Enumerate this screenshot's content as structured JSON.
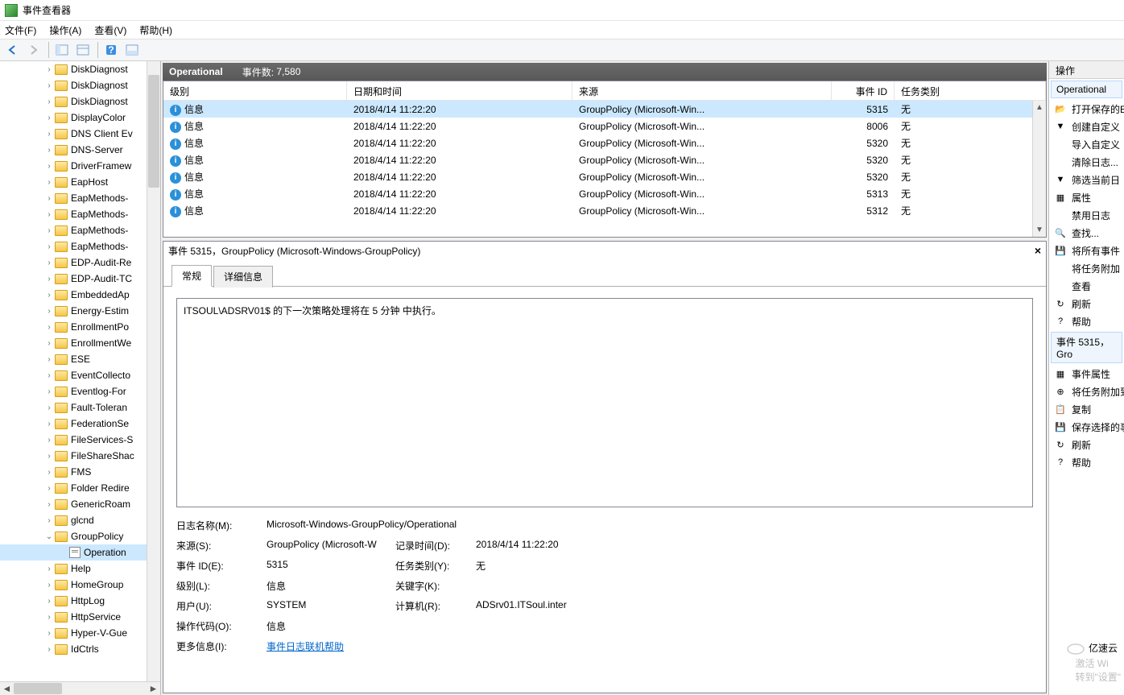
{
  "window": {
    "title": "事件查看器"
  },
  "menu": {
    "file": "文件(F)",
    "action": "操作(A)",
    "view": "查看(V)",
    "help": "帮助(H)"
  },
  "tree": {
    "items": [
      {
        "l": "DiskDiagnost",
        "d": 3
      },
      {
        "l": "DiskDiagnost",
        "d": 3
      },
      {
        "l": "DiskDiagnost",
        "d": 3
      },
      {
        "l": "DisplayColor",
        "d": 3
      },
      {
        "l": "DNS Client Ev",
        "d": 3
      },
      {
        "l": "DNS-Server",
        "d": 3
      },
      {
        "l": "DriverFramew",
        "d": 3
      },
      {
        "l": "EapHost",
        "d": 3
      },
      {
        "l": "EapMethods-",
        "d": 3
      },
      {
        "l": "EapMethods-",
        "d": 3
      },
      {
        "l": "EapMethods-",
        "d": 3
      },
      {
        "l": "EapMethods-",
        "d": 3
      },
      {
        "l": "EDP-Audit-Re",
        "d": 3
      },
      {
        "l": "EDP-Audit-TC",
        "d": 3
      },
      {
        "l": "EmbeddedAp",
        "d": 3
      },
      {
        "l": "Energy-Estim",
        "d": 3
      },
      {
        "l": "EnrollmentPo",
        "d": 3
      },
      {
        "l": "EnrollmentWe",
        "d": 3
      },
      {
        "l": "ESE",
        "d": 3
      },
      {
        "l": "EventCollecto",
        "d": 3
      },
      {
        "l": "Eventlog-For",
        "d": 3
      },
      {
        "l": "Fault-Toleran",
        "d": 3
      },
      {
        "l": "FederationSe",
        "d": 3
      },
      {
        "l": "FileServices-S",
        "d": 3
      },
      {
        "l": "FileShareShac",
        "d": 3
      },
      {
        "l": "FMS",
        "d": 3
      },
      {
        "l": "Folder Redire",
        "d": 3
      },
      {
        "l": "GenericRoam",
        "d": 3
      },
      {
        "l": "glcnd",
        "d": 3
      },
      {
        "l": "GroupPolicy",
        "d": 3,
        "exp": true
      },
      {
        "l": "Operation",
        "d": 4,
        "log": true,
        "sel": true
      },
      {
        "l": "Help",
        "d": 3
      },
      {
        "l": "HomeGroup",
        "d": 3
      },
      {
        "l": "HttpLog",
        "d": 3
      },
      {
        "l": "HttpService",
        "d": 3
      },
      {
        "l": "Hyper-V-Gue",
        "d": 3
      },
      {
        "l": "IdCtrls",
        "d": 3
      }
    ]
  },
  "log": {
    "name": "Operational",
    "count_label": "事件数:",
    "count": "7,580",
    "columns": {
      "level": "级别",
      "datetime": "日期和时间",
      "source": "来源",
      "id": "事件 ID",
      "category": "任务类别"
    },
    "rows": [
      {
        "level": "信息",
        "dt": "2018/4/14 11:22:20",
        "src": "GroupPolicy (Microsoft-Win...",
        "id": "5315",
        "cat": "无",
        "sel": true
      },
      {
        "level": "信息",
        "dt": "2018/4/14 11:22:20",
        "src": "GroupPolicy (Microsoft-Win...",
        "id": "8006",
        "cat": "无"
      },
      {
        "level": "信息",
        "dt": "2018/4/14 11:22:20",
        "src": "GroupPolicy (Microsoft-Win...",
        "id": "5320",
        "cat": "无"
      },
      {
        "level": "信息",
        "dt": "2018/4/14 11:22:20",
        "src": "GroupPolicy (Microsoft-Win...",
        "id": "5320",
        "cat": "无"
      },
      {
        "level": "信息",
        "dt": "2018/4/14 11:22:20",
        "src": "GroupPolicy (Microsoft-Win...",
        "id": "5320",
        "cat": "无"
      },
      {
        "level": "信息",
        "dt": "2018/4/14 11:22:20",
        "src": "GroupPolicy (Microsoft-Win...",
        "id": "5313",
        "cat": "无"
      },
      {
        "level": "信息",
        "dt": "2018/4/14 11:22:20",
        "src": "GroupPolicy (Microsoft-Win...",
        "id": "5312",
        "cat": "无"
      }
    ]
  },
  "detail": {
    "title": "事件 5315，GroupPolicy (Microsoft-Windows-GroupPolicy)",
    "tab_general": "常规",
    "tab_details": "详细信息",
    "message": "ITSOUL\\ADSRV01$ 的下一次策略处理将在 5 分钟 中执行。",
    "labels": {
      "logname": "日志名称(M):",
      "source": "来源(S):",
      "logged": "记录时间(D):",
      "eventid": "事件 ID(E):",
      "taskcat": "任务类别(Y):",
      "level": "级别(L):",
      "keywords": "关键字(K):",
      "user": "用户(U):",
      "computer": "计算机(R):",
      "opcode": "操作代码(O):",
      "moreinfo": "更多信息(I):"
    },
    "values": {
      "logname": "Microsoft-Windows-GroupPolicy/Operational",
      "source": "GroupPolicy (Microsoft-W",
      "logged": "2018/4/14 11:22:20",
      "eventid": "5315",
      "taskcat": "无",
      "level": "信息",
      "keywords": "",
      "user": "SYSTEM",
      "computer": "ADSrv01.ITSoul.inter",
      "opcode": "信息",
      "moreinfo": "事件日志联机帮助"
    }
  },
  "actions": {
    "header": "操作",
    "group1": "Operational",
    "items1": [
      {
        "i": "📂",
        "l": "打开保存的E"
      },
      {
        "i": "▼",
        "l": "创建自定义"
      },
      {
        "i": "",
        "l": "导入自定义"
      },
      {
        "i": "",
        "l": "清除日志..."
      },
      {
        "i": "▼",
        "l": "筛选当前日"
      },
      {
        "i": "▦",
        "l": "属性"
      },
      {
        "i": "",
        "l": "禁用日志"
      },
      {
        "i": "🔍",
        "l": "查找..."
      },
      {
        "i": "💾",
        "l": "将所有事件"
      },
      {
        "i": "",
        "l": "将任务附加"
      },
      {
        "i": "",
        "l": "查看"
      },
      {
        "i": "↻",
        "l": "刷新"
      },
      {
        "i": "?",
        "l": "帮助"
      }
    ],
    "group2": "事件 5315，Gro",
    "items2": [
      {
        "i": "▦",
        "l": "事件属性"
      },
      {
        "i": "⊕",
        "l": "将任务附加到"
      },
      {
        "i": "📋",
        "l": "复制"
      },
      {
        "i": "💾",
        "l": "保存选择的事"
      },
      {
        "i": "↻",
        "l": "刷新"
      },
      {
        "i": "?",
        "l": "帮助"
      }
    ]
  },
  "watermark": {
    "main": "激活 Wi",
    "sub": "转到\"设置\""
  },
  "brand": "亿速云"
}
